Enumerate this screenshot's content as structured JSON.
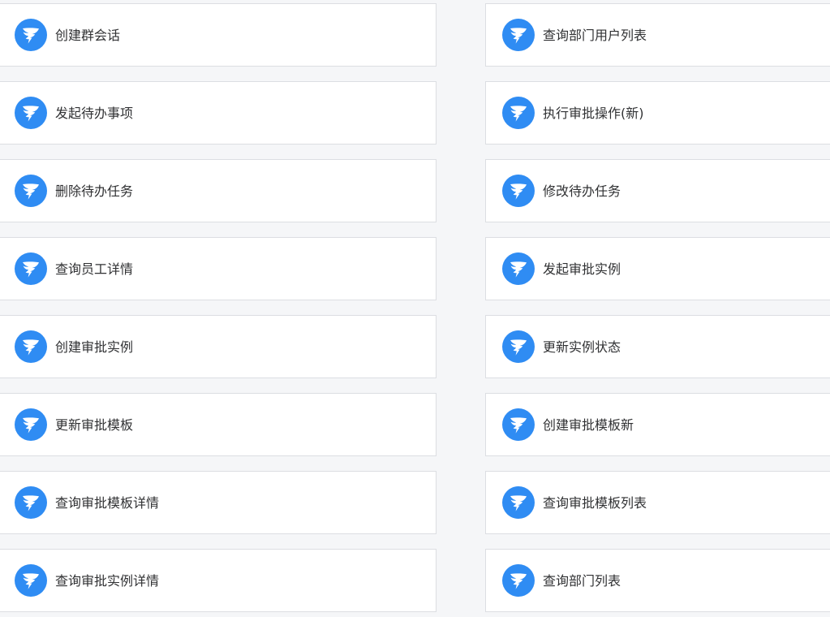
{
  "theme": {
    "accent": "#2f8cf3",
    "icon_name": "dingtalk-wing-icon"
  },
  "cards": {
    "left": [
      {
        "label": "创建群会话"
      },
      {
        "label": "发起待办事项"
      },
      {
        "label": "删除待办任务"
      },
      {
        "label": "查询员工详情"
      },
      {
        "label": "创建审批实例"
      },
      {
        "label": "更新审批模板"
      },
      {
        "label": "查询审批模板详情"
      },
      {
        "label": "查询审批实例详情"
      }
    ],
    "right": [
      {
        "label": "查询部门用户列表"
      },
      {
        "label": "执行审批操作(新)"
      },
      {
        "label": "修改待办任务"
      },
      {
        "label": "发起审批实例"
      },
      {
        "label": "更新实例状态"
      },
      {
        "label": "创建审批模板新"
      },
      {
        "label": "查询审批模板列表"
      },
      {
        "label": "查询部门列表"
      }
    ]
  }
}
